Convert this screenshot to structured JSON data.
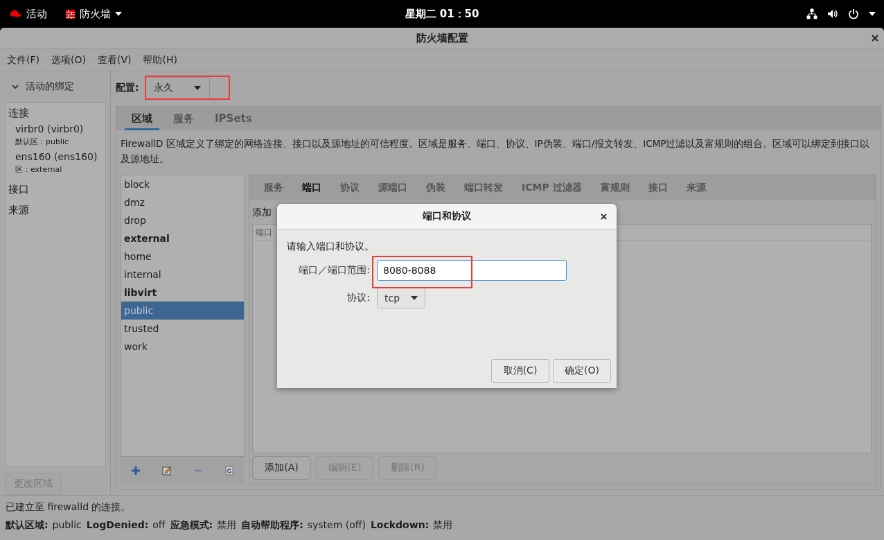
{
  "top_bar": {
    "activities": "活动",
    "app_menu": "防火墙",
    "clock": "星期二 01：50"
  },
  "window": {
    "title": "防火墙配置"
  },
  "menu": [
    "文件(F)",
    "选项(O)",
    "查看(V)",
    "帮助(H)"
  ],
  "sidebar": {
    "header": "活动的绑定",
    "expanded": true,
    "sections": [
      {
        "title": "连接",
        "items": [
          {
            "name": "virbr0 (virbr0)",
            "zone": "默认区：public"
          },
          {
            "name": "ens160 (ens160)",
            "zone": "区：external"
          }
        ]
      },
      {
        "title": "接口"
      },
      {
        "title": "来源"
      }
    ],
    "button": {
      "label": "更改区域",
      "disabled": true
    }
  },
  "config": {
    "label": "配置:",
    "value": "永久"
  },
  "tabs": [
    {
      "label": "区域",
      "selected": true
    },
    {
      "label": "服务",
      "selected": false
    },
    {
      "label": "IPSets",
      "selected": false
    }
  ],
  "description": "FirewallD 区域定义了绑定的网络连接、接口以及源地址的可信程度。区域是服务、端口、协议、IP伪装、端口/报文转发、ICMP过滤以及富规则的组合。区域可以绑定到接口以及源地址。",
  "zones": [
    {
      "name": "block",
      "active": false,
      "selected": false
    },
    {
      "name": "dmz",
      "active": false,
      "selected": false
    },
    {
      "name": "drop",
      "active": false,
      "selected": false
    },
    {
      "name": "external",
      "active": true,
      "selected": false
    },
    {
      "name": "home",
      "active": false,
      "selected": false
    },
    {
      "name": "internal",
      "active": false,
      "selected": false
    },
    {
      "name": "libvirt",
      "active": true,
      "selected": false
    },
    {
      "name": "public",
      "active": false,
      "selected": true
    },
    {
      "name": "trusted",
      "active": false,
      "selected": false
    },
    {
      "name": "work",
      "active": false,
      "selected": false
    }
  ],
  "zone_tabs": [
    {
      "label": "服务",
      "selected": false
    },
    {
      "label": "端口",
      "selected": true
    },
    {
      "label": "协议",
      "selected": false
    },
    {
      "label": "源端口",
      "selected": false
    },
    {
      "label": "伪装",
      "selected": false
    },
    {
      "label": "端口转发",
      "selected": false
    },
    {
      "label": "ICMP 过滤器",
      "selected": false
    },
    {
      "label": "富规则",
      "selected": false
    },
    {
      "label": "接口",
      "selected": false
    },
    {
      "label": "来源",
      "selected": false
    }
  ],
  "ports": {
    "hint": "添加",
    "column": "端口"
  },
  "port_buttons": [
    {
      "label": "添加(A)",
      "disabled": false
    },
    {
      "label": "编辑(E)",
      "disabled": true
    },
    {
      "label": "删除(R)",
      "disabled": true
    }
  ],
  "status": {
    "message": "已建立至 firewalld 的连接。",
    "fields": [
      {
        "label": "默认区域:",
        "value": "public"
      },
      {
        "label": "LogDenied:",
        "value": "off"
      },
      {
        "label": "应急模式:",
        "value": "禁用"
      },
      {
        "label": "自动帮助程序:",
        "value": "system (off)"
      },
      {
        "label": "Lockdown:",
        "value": "禁用"
      }
    ]
  },
  "dialog": {
    "title": "端口和协议",
    "prompt": "请输入端口和协议。",
    "port_label": "端口／端口范围:",
    "port_value": "8080-8088",
    "protocol_label": "协议:",
    "protocol_value": "tcp",
    "buttons": [
      "取消(C)",
      "确定(O)"
    ]
  }
}
